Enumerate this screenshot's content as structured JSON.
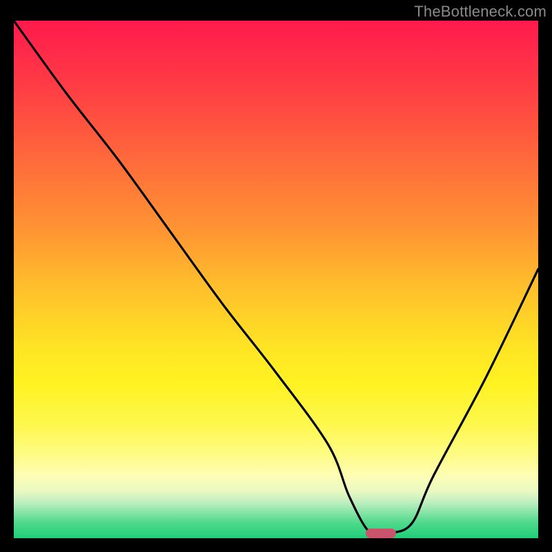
{
  "watermark": "TheBottleneck.com",
  "marker": {
    "x_pct": 70,
    "y_pct": 99
  },
  "chart_data": {
    "type": "line",
    "title": "",
    "xlabel": "",
    "ylabel": "",
    "xlim": [
      0,
      100
    ],
    "ylim": [
      0,
      100
    ],
    "series": [
      {
        "name": "bottleneck-curve",
        "x": [
          0,
          10,
          20,
          30,
          40,
          50,
          60,
          64,
          68,
          72,
          76,
          80,
          90,
          100
        ],
        "y": [
          100,
          86,
          73,
          59,
          45,
          32,
          18,
          8,
          1,
          1,
          3,
          12,
          31,
          52
        ]
      }
    ],
    "gradient_stops": [
      {
        "pos": 0,
        "color": "#ff1a4b"
      },
      {
        "pos": 50,
        "color": "#ffba2c"
      },
      {
        "pos": 80,
        "color": "#fefc86"
      },
      {
        "pos": 100,
        "color": "#1fcf78"
      }
    ]
  }
}
